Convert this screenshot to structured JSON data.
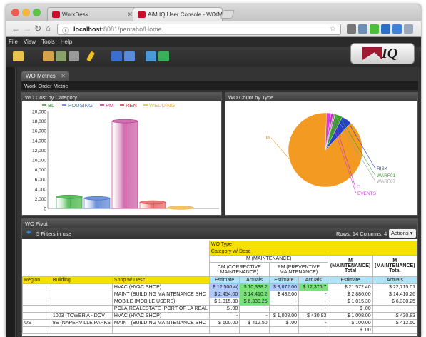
{
  "browser": {
    "tabs": [
      {
        "label": "WorkDesk",
        "active": false
      },
      {
        "label": "AiM IQ User Console - WO M",
        "active": true
      }
    ],
    "url_host": "localhost",
    "url_rest": ":8081/pentaho/Home"
  },
  "app": {
    "menu": [
      "File",
      "View",
      "Tools",
      "Help"
    ],
    "logo_text": "IQ",
    "tab_label": "WO Metrics",
    "metric_title": "Work Order Metric"
  },
  "bar_panel": {
    "title": "WO Cost by Category"
  },
  "pie_panel": {
    "title": "WO Count by Type"
  },
  "chart_data": [
    {
      "type": "bar",
      "title": "WO Cost by Category",
      "series": [
        {
          "name": "BL",
          "color": "#2e8b3a"
        },
        {
          "name": "HOUSING",
          "color": "#3a6fd8"
        },
        {
          "name": "PM",
          "color": "#c0207a"
        },
        {
          "name": "REN",
          "color": "#e0303a"
        },
        {
          "name": "WEDDING",
          "color": "#f0b030"
        }
      ],
      "values": [
        2400,
        2100,
        18000,
        1250,
        150
      ],
      "bar_colors": [
        "#5fbf5f",
        "#6f93d8",
        "#d070b0",
        "#e87777",
        "#f3c266"
      ],
      "ylim": [
        0,
        20000
      ],
      "yticks": [
        "20,000",
        "18,000",
        "16,000",
        "14,000",
        "12,000",
        "10,000",
        "8,000",
        "6,000",
        "4,000",
        "2,000",
        "0"
      ]
    },
    {
      "type": "pie",
      "title": "WO Count by Type",
      "slices": [
        {
          "label": "M",
          "value": 88.5,
          "color": "#f39a22"
        },
        {
          "label": "RISK",
          "value": 4.5,
          "color": "#2640c8"
        },
        {
          "label": "WARF01",
          "value": 3.2,
          "color": "#3aa02a"
        },
        {
          "label": "WARF07",
          "value": 0.9,
          "color": "#9aa09a"
        },
        {
          "label": "C",
          "value": 0.9,
          "color": "#c030c0"
        },
        {
          "label": "EVENTS",
          "value": 2.0,
          "color": "#d040d8"
        }
      ]
    }
  ],
  "pivot": {
    "title": "WO Pivot",
    "filters": "5 Filters in use",
    "rows_cols": "Rows: 14  Columns: 4",
    "actions": "Actions",
    "h_wotype": "WO Type",
    "h_category": "Category w/ Desc",
    "h_m": "M (MAINTENANCE)",
    "h_cm": "CM (CORRECTIVE MAINTENANCE)",
    "h_pm": "PM (PREVENTIVE MAINTENANCE)",
    "h_mt1": "M (MAINTENANCE) Total",
    "h_mt2": "M (MAINTENANCE) Total",
    "h_est": "Estimate",
    "h_act": "Actuals",
    "h_region": "Region",
    "h_building": "Building",
    "h_shop": "Shop w/ Desc",
    "rows": [
      {
        "region": "",
        "building": "",
        "shop": "HVAC (HVAC SHOP)",
        "v": [
          "$ 12,500.4(",
          "$ 10,338.2",
          "$ 9,072.00",
          "$ 12,376.7",
          "$ 21,572.40",
          "$ 22,715.01"
        ]
      },
      {
        "region": "",
        "building": "",
        "shop": "MAINT (BUILDING MAINTENANCE SHC",
        "v": [
          "$ 2,454.00",
          "$ 14,410.2",
          "$ 432.00",
          "-",
          "$ 2,886.00",
          "$ 14,410.26"
        ]
      },
      {
        "region": "",
        "building": "",
        "shop": "MOBILE (MOBILE USERS)",
        "v": [
          "$ 1,015.30",
          "$ 6,330.25",
          "-",
          "-",
          "$ 1,015.30",
          "$ 6,330.25"
        ]
      },
      {
        "region": "",
        "building": "",
        "shop": "POLA-REALESTATE (PORT OF LA REAL",
        "v": [
          "$ .00",
          "-",
          "-",
          "-",
          "$ .00",
          "-"
        ]
      },
      {
        "region": "",
        "building": "1003 (TOWER A - DOV",
        "shop": "HVAC (HVAC SHOP)",
        "v": [
          "-",
          "-",
          "$ 1,008.00",
          "$ 430.83",
          "$ 1,008.00",
          "$ 430.83"
        ]
      },
      {
        "region": "US",
        "building": "8E (NAPERVILLE PARKS",
        "shop": "MAINT (BUILDING MAINTENANCE SHC",
        "v": [
          "$ 100.00",
          "$ 412.50",
          "$ .00",
          "-",
          "$ 100.00",
          "$ 412.50"
        ]
      },
      {
        "region": "",
        "building": "",
        "shop": "",
        "v": [
          "",
          "",
          "",
          "",
          "$ .00",
          ""
        ]
      }
    ]
  }
}
